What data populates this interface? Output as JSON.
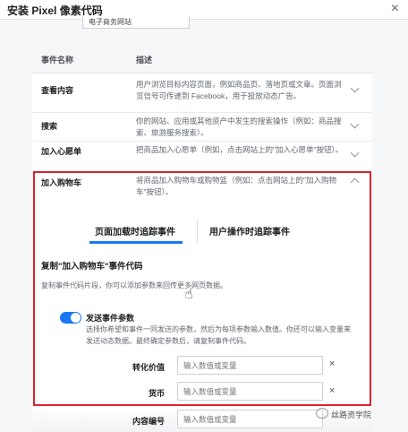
{
  "dialog": {
    "title": "安装 Pixel 像素代码",
    "close_glyph": "×",
    "dropdown_text": "电子商务网站"
  },
  "table": {
    "headers": {
      "name": "事件名称",
      "description": "描述"
    },
    "rows": [
      {
        "name": "查看内容",
        "description": "用户浏览目标内容页面，例如商品页、落地页或文章。页面浏览信号可传递到 Facebook，用于投放动态广告。"
      },
      {
        "name": "搜索",
        "description": "你的网站、应用或其他资产中发生的搜索操作（例如：商品搜索、旅游服务搜索）。"
      },
      {
        "name": "加入心愿单",
        "description": "把商品加入心愿单（例如，点击网站上的\"加入心愿单\"按钮）。"
      },
      {
        "name": "加入购物车",
        "description": "将商品加入购物车或购物篮（例如：点击网站上的\"加入购物车\"按钮）。"
      }
    ]
  },
  "expanded": {
    "tabs": [
      {
        "label": "页面加载时追踪事件"
      },
      {
        "label": "用户操作时追踪事件"
      }
    ],
    "section_title": "复制\"加入购物车\"事件代码",
    "section_sub": "复制事件代码片段，你可以添加参数来回传更多网页数据。",
    "toggle_label": "发送事件参数",
    "toggle_desc": "选择你希望和事件一同发送的参数，然后为每项参数输入数值。你还可以输入变量来发送动态数据。最终确定参数后，请复制事件代码。",
    "fields": [
      {
        "label": "转化价值",
        "placeholder": "输入数值或变量"
      },
      {
        "label": "货币",
        "placeholder": "输入数值或变量"
      },
      {
        "label": "内容编号",
        "placeholder": "输入数值或变量"
      }
    ]
  },
  "watermark": "丝路资学院",
  "colors": {
    "accent": "#1877f2",
    "highlight": "#d8262f"
  }
}
